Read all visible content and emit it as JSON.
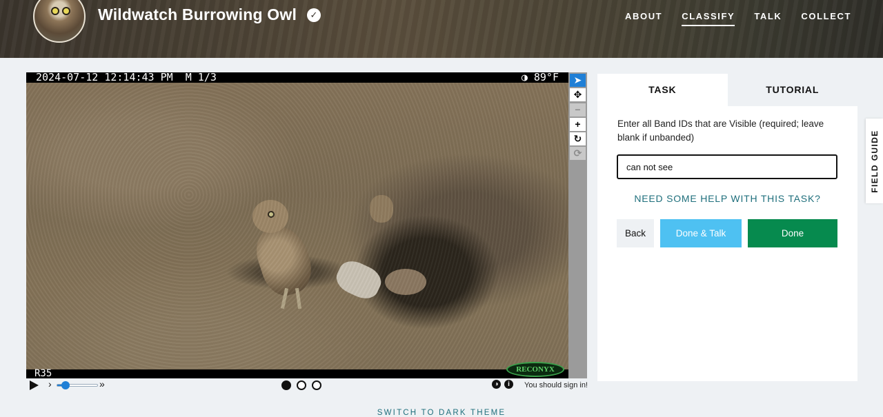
{
  "header": {
    "project_title": "Wildwatch Burrowing Owl",
    "verified_icon": "check-badge-icon",
    "nav": [
      {
        "label": "ABOUT",
        "active": false
      },
      {
        "label": "CLASSIFY",
        "active": true
      },
      {
        "label": "TALK",
        "active": false
      },
      {
        "label": "COLLECT",
        "active": false
      }
    ]
  },
  "viewer": {
    "camera_stamp": "2024-07-12 12:14:43 PM  M 1/3",
    "camera_temp": "◑  89°F",
    "camera_id": "R35",
    "camera_brand": "RECONYX",
    "tools": [
      {
        "name": "pointer-tool",
        "glyph": "➤",
        "state": "active"
      },
      {
        "name": "pan-tool",
        "glyph": "✥",
        "state": "normal"
      },
      {
        "name": "zoom-out-tool",
        "glyph": "−",
        "state": "disabled"
      },
      {
        "name": "zoom-in-tool",
        "glyph": "+",
        "state": "normal"
      },
      {
        "name": "rotate-tool",
        "glyph": "↻",
        "state": "normal"
      },
      {
        "name": "reset-tool",
        "glyph": "⟳",
        "state": "disabled"
      }
    ],
    "frame_dots": [
      true,
      false,
      false
    ],
    "slow_glyph": "›",
    "fast_glyph": "»",
    "speed_fraction": 0.2,
    "invert_icon_glyph": "◑",
    "info_icon_glyph": "i",
    "signin_notice": "You should sign in!"
  },
  "task": {
    "tabs": [
      "TASK",
      "TUTORIAL"
    ],
    "instruction": "Enter all Band IDs that are Visible (required; leave blank if unbanded)",
    "answer_value": "can not see",
    "help_link": "NEED SOME HELP WITH THIS TASK?",
    "back_label": "Back",
    "done_talk_label": "Done & Talk",
    "done_label": "Done"
  },
  "field_guide_label": "FIELD GUIDE",
  "theme_toggle": "SWITCH TO DARK THEME"
}
